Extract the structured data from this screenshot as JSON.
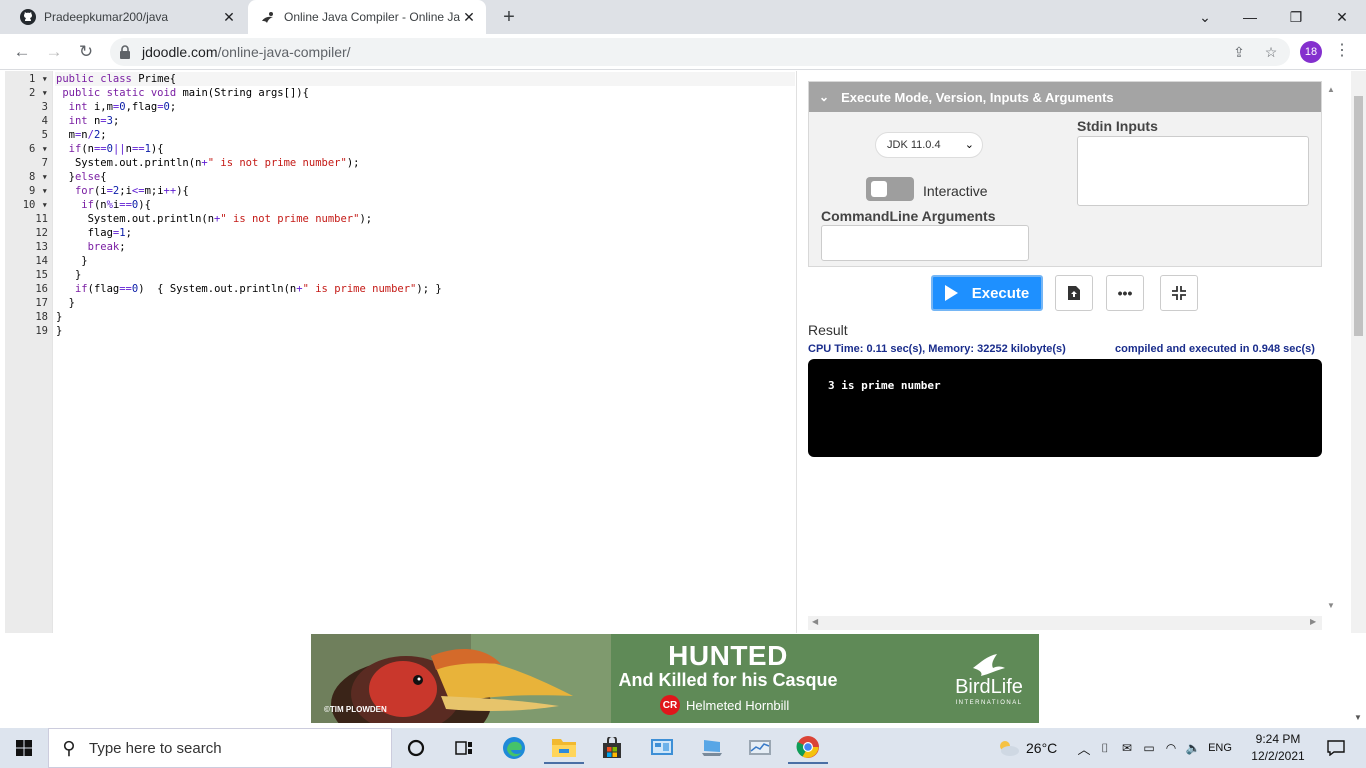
{
  "browser": {
    "tabs": [
      {
        "title": "Pradeepkumar200/java",
        "icon": "github-icon"
      },
      {
        "title": "Online Java Compiler - Online Ja",
        "icon": "jdoodle-icon"
      }
    ],
    "url_domain": "jdoodle.com",
    "url_path": "/online-java-compiler/",
    "profile_badge": "18"
  },
  "editor": {
    "line_numbers": [
      "1",
      "2",
      "3",
      "4",
      "5",
      "6",
      "7",
      "8",
      "9",
      "10",
      "11",
      "12",
      "13",
      "14",
      "15",
      "16",
      "17",
      "18",
      "19"
    ],
    "fold_lines": [
      "1",
      "2",
      "6",
      "8",
      "9",
      "10"
    ]
  },
  "execute_panel": {
    "header": "Execute Mode, Version, Inputs & Arguments",
    "jdk_version": "JDK 11.0.4",
    "interactive_label": "Interactive",
    "stdin_label": "Stdin Inputs",
    "cmdline_label": "CommandLine Arguments",
    "execute_label": "Execute"
  },
  "result": {
    "label": "Result",
    "cpu_info": "CPU Time: 0.11 sec(s), Memory: 32252 kilobyte(s)",
    "compiled_info": "compiled and executed in 0.948 sec(s)",
    "output": "3 is prime number"
  },
  "ad": {
    "headline": "HUNTED",
    "subline": "And Killed for his Casque",
    "badge": "CR",
    "species": "Helmeted Hornbill",
    "credit": "©TIM PLOWDEN",
    "brand": "BirdLife",
    "brand_sub": "INTERNATIONAL"
  },
  "taskbar": {
    "search_placeholder": "Type here to search",
    "temperature": "26°C",
    "language": "ENG",
    "time": "9:24 PM",
    "date": "12/2/2021"
  },
  "colors": {
    "execute_button": "#1e90ff",
    "panel_header": "#a4a4a4",
    "result_text": "#1a2d8c",
    "ad_background": "#5f8a57"
  }
}
